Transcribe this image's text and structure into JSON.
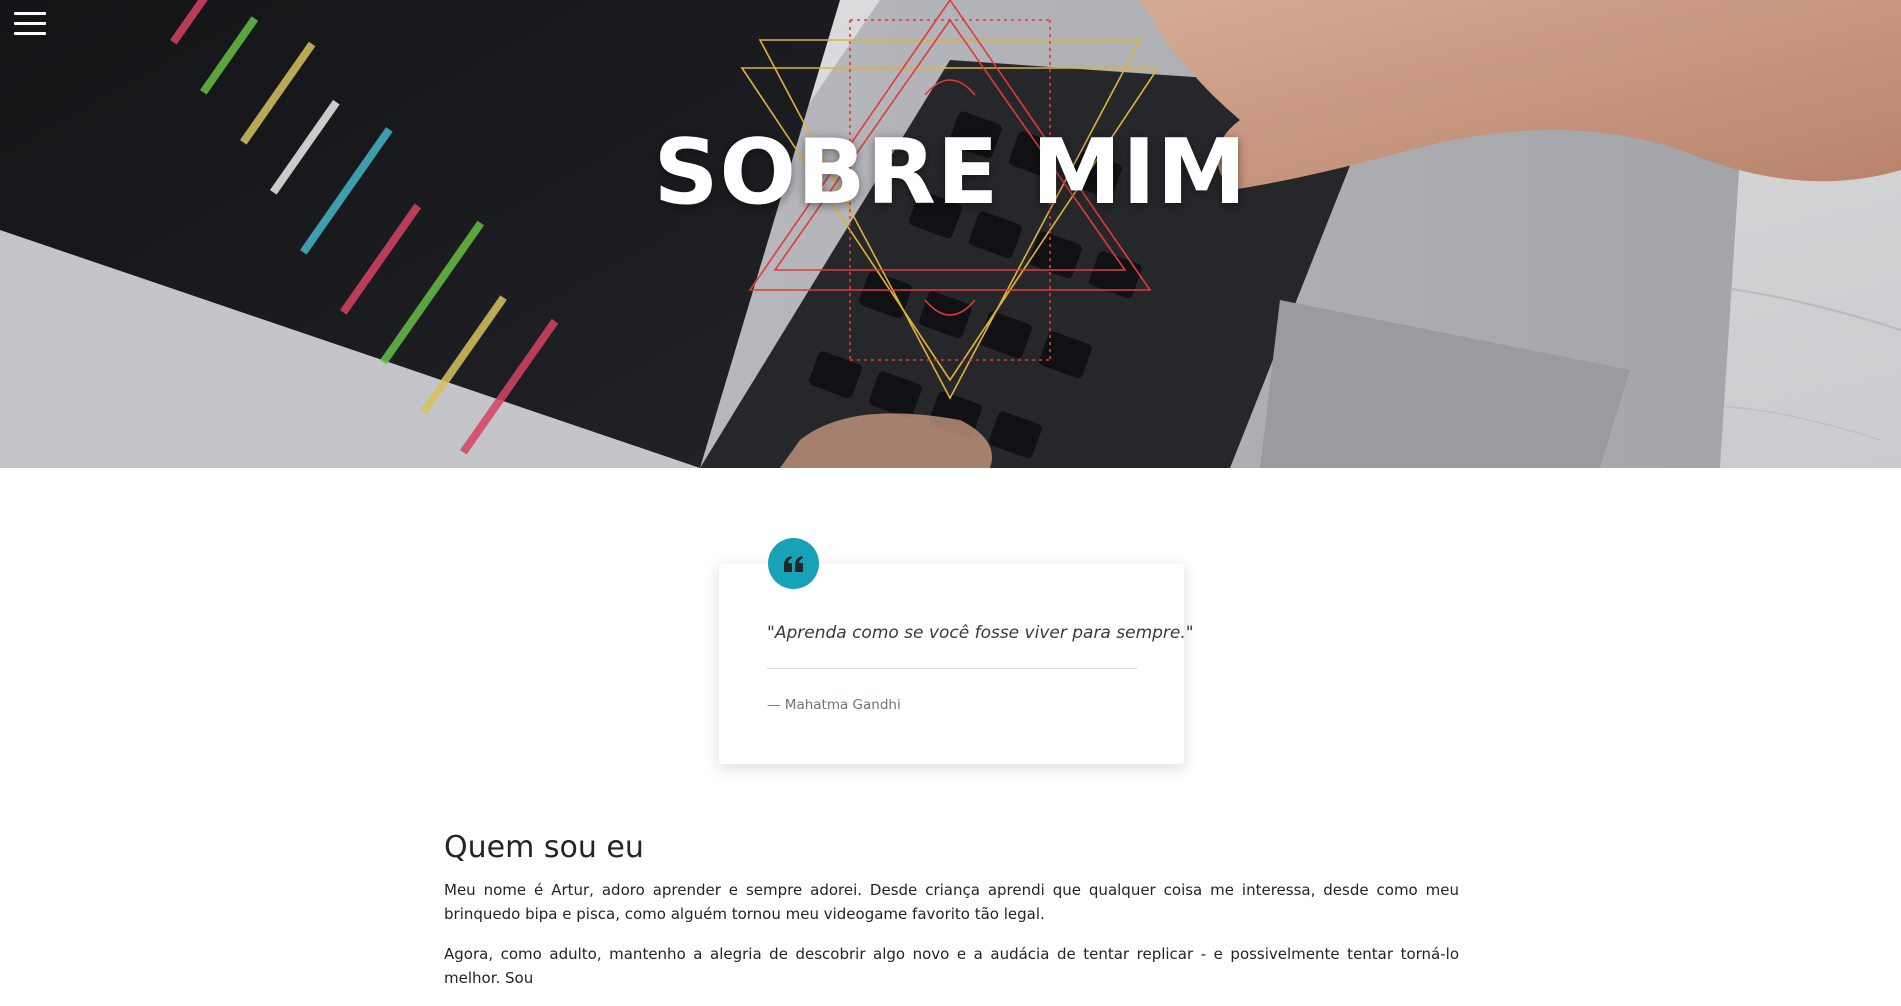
{
  "menu": {
    "icon": "hamburger-icon"
  },
  "hero": {
    "title": "SOBRE MIM",
    "background": "laptop-keyboard-photo"
  },
  "quote": {
    "icon": "quote-icon",
    "accent_color": "#17a2b8",
    "text": "\"Aprenda como se você fosse viver para sempre.\"",
    "author": "— Mahatma Gandhi"
  },
  "about": {
    "title": "Quem sou eu",
    "paragraphs": [
      "Meu nome é Artur, adoro aprender e sempre adorei. Desde criança aprendi que qualquer coisa me interessa, desde como meu brinquedo bipa e pisca, como alguém tornou meu videogame favorito tão legal.",
      "Agora, como adulto, mantenho a alegria de descobrir algo novo e a audácia de tentar replicar - e possivelmente tentar torná-lo melhor. Sou"
    ]
  }
}
